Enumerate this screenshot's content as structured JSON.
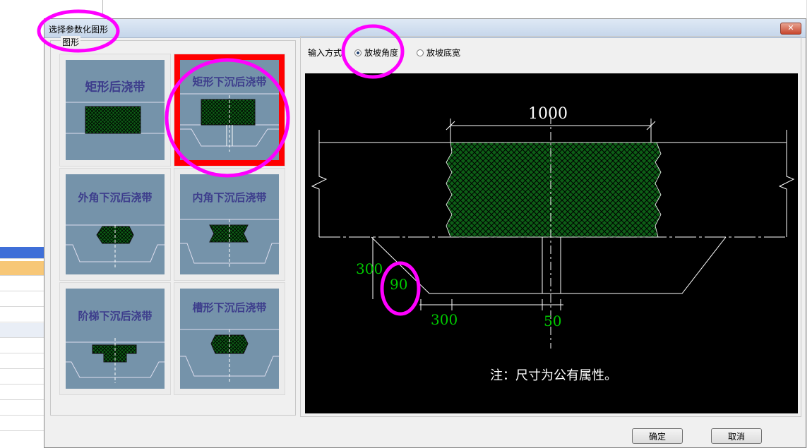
{
  "dialog": {
    "title": "选择参数化图形",
    "close_label": "✕",
    "shapes_group_label": "图形",
    "input_mode_label": "输入方式",
    "radio_angle_label": "放坡角度",
    "radio_width_label": "放坡底宽",
    "ok_label": "确定",
    "cancel_label": "取消"
  },
  "shapes": [
    {
      "label": "矩形后浇带",
      "selected": false
    },
    {
      "label": "矩形下沉后浇带",
      "selected": true
    },
    {
      "label": "外角下沉后浇带",
      "selected": false
    },
    {
      "label": "内角下沉后浇带",
      "selected": false
    },
    {
      "label": "阶梯下沉后浇带",
      "selected": false
    },
    {
      "label": "槽形下沉后浇带",
      "selected": false
    }
  ],
  "preview": {
    "dim_top": "1000",
    "dim_depth": "300",
    "dim_angle": "90",
    "dim_offset": "300",
    "dim_gap": "50",
    "note": "注：尺寸为公有属性。"
  },
  "colors": {
    "hatch_green": "#0d5e16",
    "dim_green": "#00c800",
    "selection_red": "#ff0000",
    "thumb_blue": "#7593aa",
    "thumb_text": "#3d3d8c",
    "annotation_magenta": "#ff00ff"
  }
}
